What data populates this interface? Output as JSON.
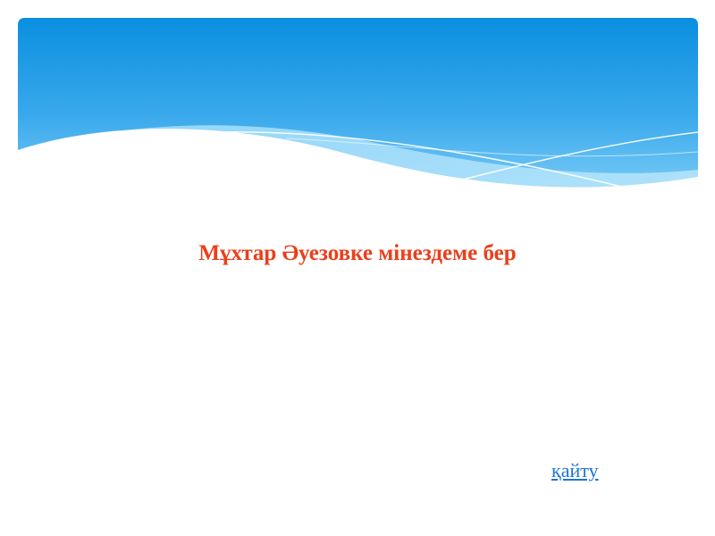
{
  "slide": {
    "title": "Мұхтар Әуезовке мінездеме бер",
    "back_link": "қайту"
  },
  "colors": {
    "banner_top": "#0a8fe0",
    "banner_bottom": "#6cc6f5",
    "title_color": "#e8401c",
    "link_color": "#1f73d6"
  }
}
